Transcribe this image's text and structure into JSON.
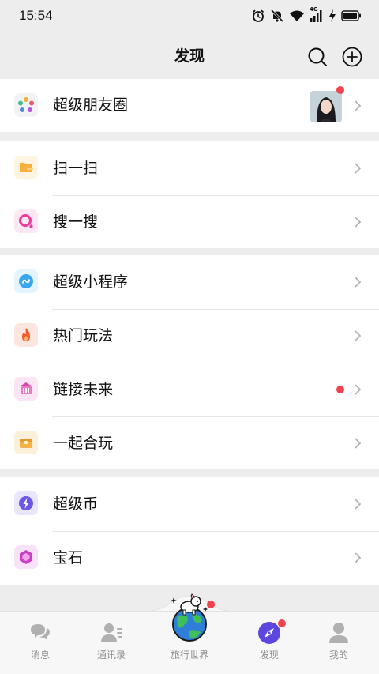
{
  "status_bar": {
    "time": "15:54",
    "network": "4G",
    "icons": [
      "alarm-icon",
      "mute-icon",
      "wifi-icon",
      "signal-icon",
      "charging-icon",
      "battery-icon"
    ]
  },
  "nav": {
    "title": "发现",
    "icons": [
      "search-icon",
      "add-circle-icon"
    ]
  },
  "groups": [
    {
      "items": [
        {
          "label": "超级朋友圈",
          "icon": "moments-icon",
          "has_avatar": true,
          "red_dot": true
        }
      ]
    },
    {
      "items": [
        {
          "label": "扫一扫",
          "icon": "scan-icon"
        },
        {
          "label": "搜一搜",
          "icon": "search-feature-icon"
        }
      ]
    },
    {
      "items": [
        {
          "label": "超级小程序",
          "icon": "mini-program-icon"
        },
        {
          "label": "热门玩法",
          "icon": "fire-icon"
        },
        {
          "label": "链接未来",
          "icon": "building-icon",
          "red_dot": true
        },
        {
          "label": "一起合玩",
          "icon": "game-box-icon"
        }
      ]
    },
    {
      "items": [
        {
          "label": "超级币",
          "icon": "coin-bolt-icon"
        },
        {
          "label": "宝石",
          "icon": "gem-icon"
        }
      ]
    }
  ],
  "tabs": [
    {
      "label": "消息",
      "icon": "chat-bubbles-icon",
      "active": false
    },
    {
      "label": "通讯录",
      "icon": "contacts-icon",
      "active": false
    },
    {
      "label": "旅行世界",
      "icon": "globe-icon",
      "active": false,
      "red_dot": true
    },
    {
      "label": "发现",
      "icon": "compass-icon",
      "active": true,
      "red_dot": true
    },
    {
      "label": "我的",
      "icon": "person-icon",
      "active": false
    }
  ],
  "colors": {
    "accent": "#5b47e0",
    "badge": "#f0434b",
    "background": "#ededed"
  }
}
